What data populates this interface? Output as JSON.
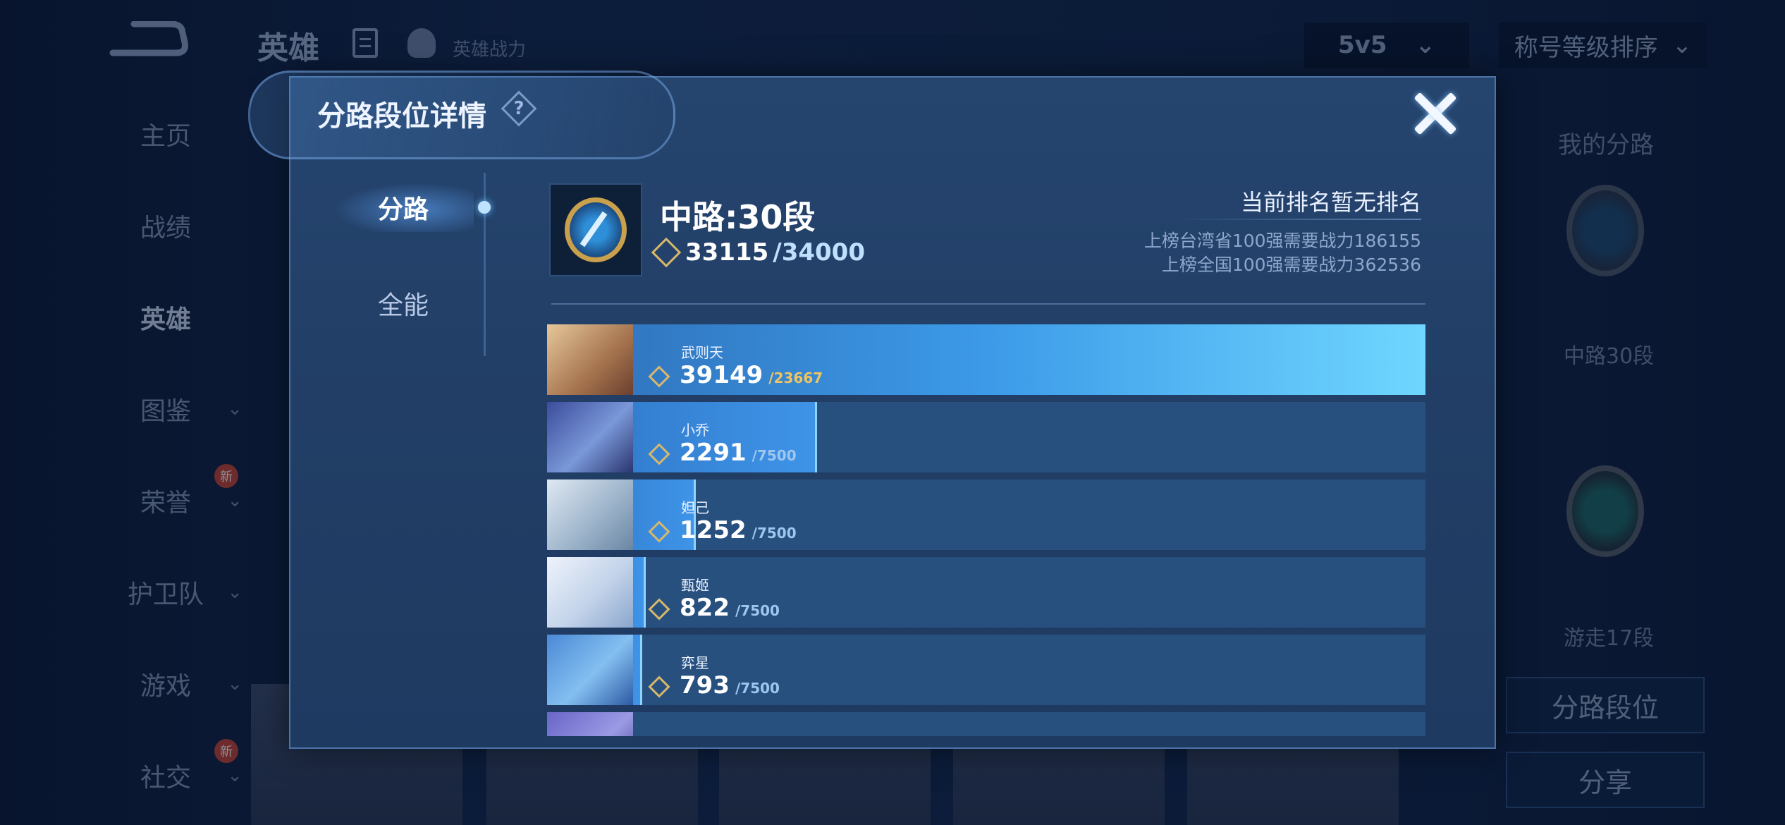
{
  "app": {
    "title": "英雄",
    "power_label": "英雄战力",
    "mode_select": "5v5",
    "sort_select": "称号等级排序"
  },
  "side_nav": [
    {
      "label": "主页",
      "active": false,
      "chevron": false,
      "new": false
    },
    {
      "label": "战绩",
      "active": false,
      "chevron": false,
      "new": false
    },
    {
      "label": "英雄",
      "active": true,
      "chevron": false,
      "new": false
    },
    {
      "label": "图鉴",
      "active": false,
      "chevron": true,
      "new": false
    },
    {
      "label": "荣誉",
      "active": false,
      "chevron": true,
      "new": true
    },
    {
      "label": "护卫队",
      "active": false,
      "chevron": true,
      "new": false
    },
    {
      "label": "游戏",
      "active": false,
      "chevron": true,
      "new": false
    },
    {
      "label": "社交",
      "active": false,
      "chevron": true,
      "new": true
    }
  ],
  "new_badge": "新",
  "right_panel": {
    "title": "我的分路",
    "lane1_caption": "中路30段",
    "lane2_caption": "游走17段",
    "lane_rank_button": "分路段位",
    "share_button": "分享"
  },
  "modal": {
    "title": "分路段位详情",
    "help": "?",
    "tabs": [
      {
        "label": "分路",
        "active": true
      },
      {
        "label": "全能",
        "active": false
      }
    ],
    "lane": {
      "title": "中路:30段",
      "power": "33115",
      "power_max": "/34000"
    },
    "rank": {
      "status": "当前排名暂无排名",
      "province_line": "上榜台湾省100强需要战力186155",
      "national_line": "上榜全国100强需要战力362536"
    },
    "heroes": [
      {
        "name": "武则天",
        "score": "39149",
        "max": "/23667",
        "fill": 1.0,
        "top": true
      },
      {
        "name": "小乔",
        "score": "2291",
        "max": "/7500",
        "fill": 0.305
      },
      {
        "name": "妲己",
        "score": "1252",
        "max": "/7500",
        "fill": 0.167
      },
      {
        "name": "甄姬",
        "score": "822",
        "max": "/7500",
        "fill": 0.11
      },
      {
        "name": "弈星",
        "score": "793",
        "max": "/7500",
        "fill": 0.106
      },
      {
        "name": "",
        "score": "",
        "max": "",
        "fill": 0.09
      }
    ]
  },
  "colors": {
    "accent": "#6fd6ff",
    "gold": "#d8b86a",
    "panel": "#223f67"
  }
}
